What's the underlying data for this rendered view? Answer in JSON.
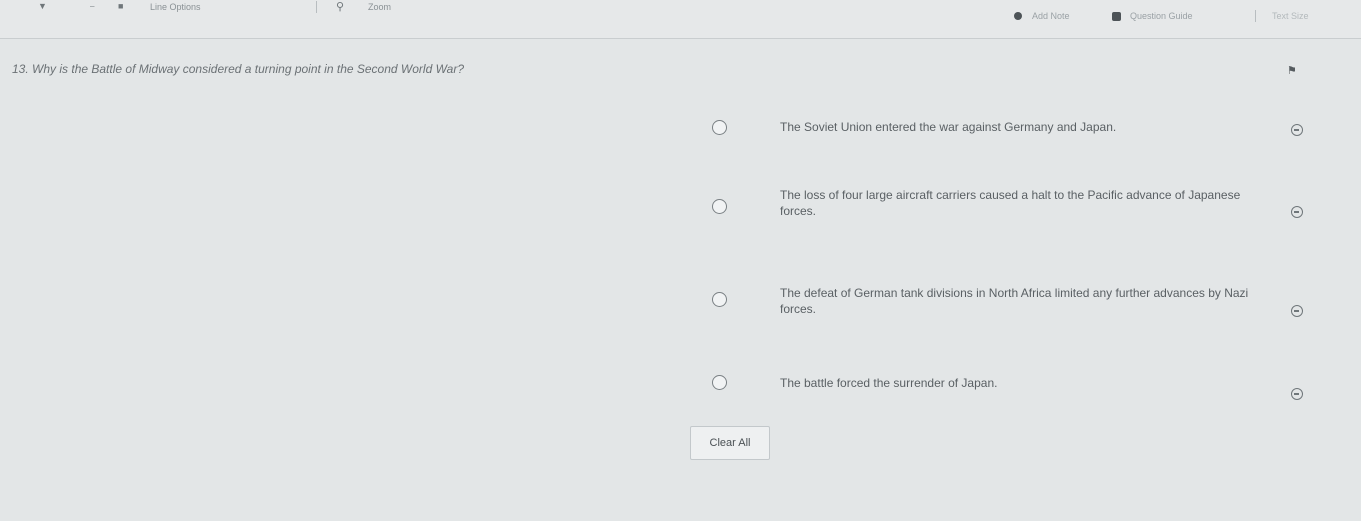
{
  "toolbar": {
    "item1": "Line Options",
    "item2": "Zoom",
    "right1": "Add Note",
    "right2": "Question Guide",
    "right3": "Text Size"
  },
  "question": {
    "number": "13.",
    "text": "Why is the Battle of Midway considered a turning point in the Second World War?"
  },
  "options": [
    {
      "text": "The Soviet Union entered the war against Germany and Japan."
    },
    {
      "text": "The loss of four large aircraft carriers caused a halt to the Pacific advance of Japanese forces."
    },
    {
      "text": "The defeat of German tank divisions in North Africa limited any further advances by Nazi forces."
    },
    {
      "text": "The battle forced the surrender of Japan."
    }
  ],
  "clear_all_label": "Clear All",
  "icons": {
    "flag": "flag-icon",
    "eliminate": "eliminate-icon",
    "zoom": "zoom-icon"
  }
}
